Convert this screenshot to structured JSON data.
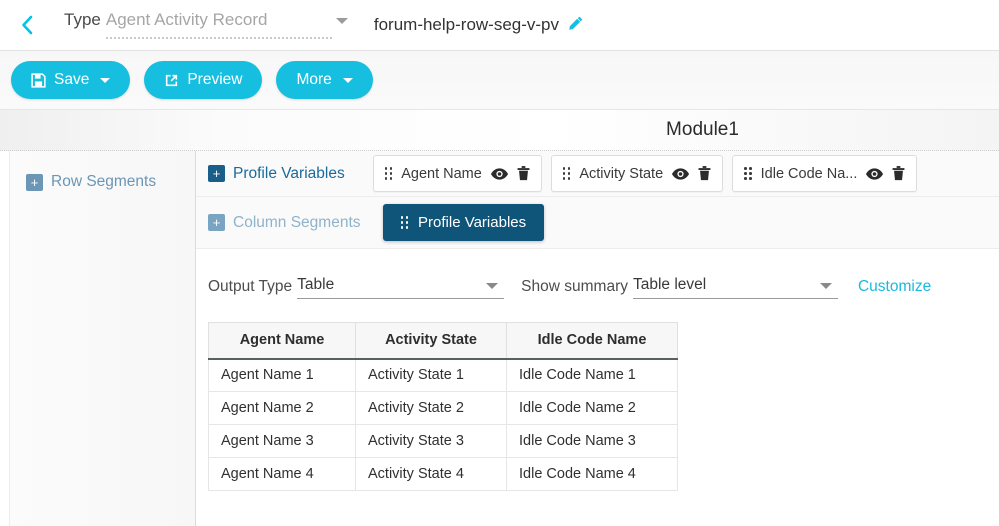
{
  "header": {
    "back_icon": "chevron-left-icon",
    "type_label": "Type",
    "type_value": "Agent Activity Record",
    "document_title": "forum-help-row-seg-v-pv",
    "edit_icon": "pencil-icon"
  },
  "toolbar": {
    "save_label": "Save",
    "save_icon": "floppy-disk-icon",
    "preview_label": "Preview",
    "preview_icon": "external-link-icon",
    "more_label": "More"
  },
  "module": {
    "title": "Module1"
  },
  "sidebar": {
    "row_segments_label": "Row Segments"
  },
  "segments": {
    "profile_variables_label": "Profile Variables",
    "column_segments_label": "Column Segments",
    "column_chip_label": "Profile Variables",
    "chips": [
      {
        "label": "Agent Name",
        "eye_icon": "eye-icon",
        "delete_icon": "trash-icon"
      },
      {
        "label": "Activity State",
        "eye_icon": "eye-icon",
        "delete_icon": "trash-icon"
      },
      {
        "label": "Idle Code Na...",
        "eye_icon": "eye-icon",
        "delete_icon": "trash-icon"
      }
    ]
  },
  "controls": {
    "output_type_label": "Output Type",
    "output_type_value": "Table",
    "show_summary_label": "Show summary",
    "show_summary_value": "Table level",
    "customize_label": "Customize"
  },
  "table": {
    "columns": [
      "Agent Name",
      "Activity State",
      "Idle Code Name"
    ],
    "rows": [
      [
        "Agent Name 1",
        "Activity State 1",
        "Idle Code Name 1"
      ],
      [
        "Agent Name 2",
        "Activity State 2",
        "Idle Code Name 2"
      ],
      [
        "Agent Name 3",
        "Activity State 3",
        "Idle Code Name 3"
      ],
      [
        "Agent Name 4",
        "Activity State 4",
        "Idle Code Name 4"
      ]
    ]
  },
  "colors": {
    "accent_cyan": "#16bfe0",
    "chip_dark_blue": "#0f5479",
    "sidebar_blue": "#6b96b5"
  }
}
